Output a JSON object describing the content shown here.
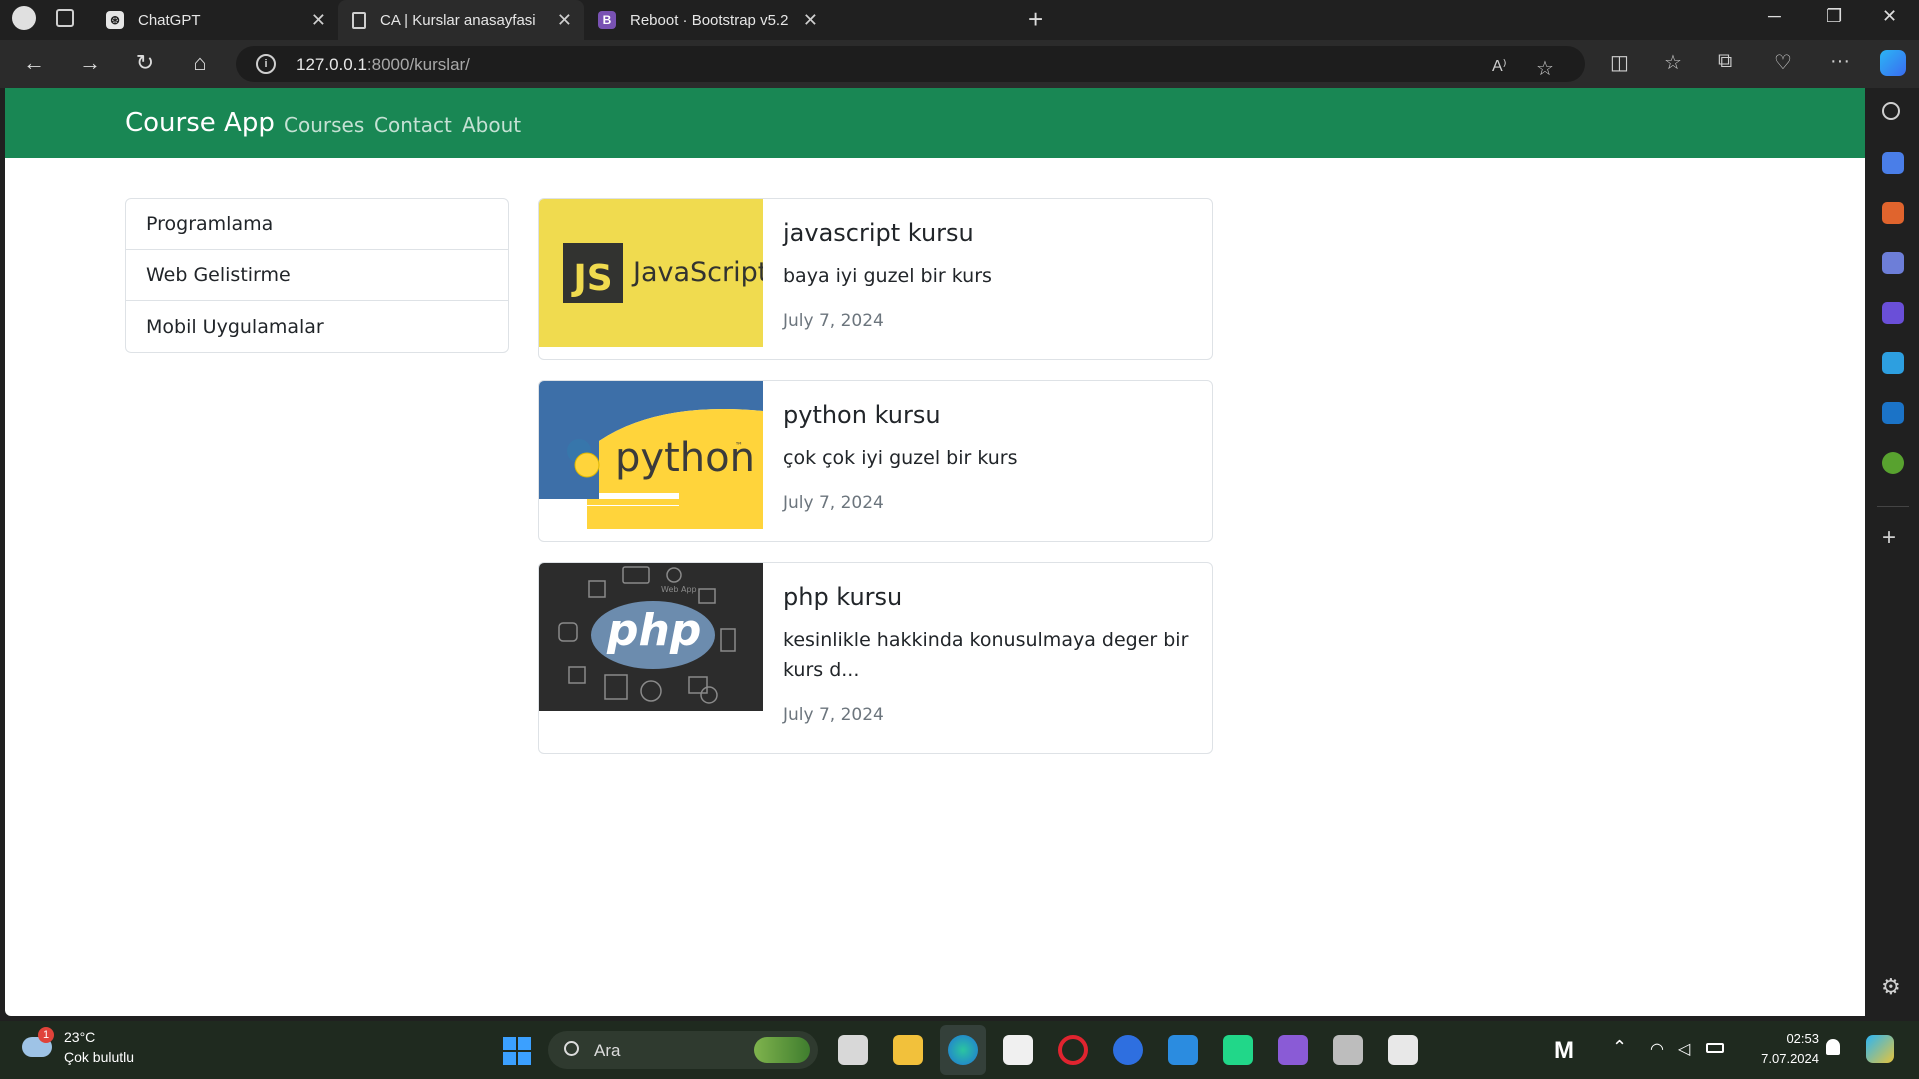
{
  "browser": {
    "tabs": [
      {
        "title": "ChatGPT"
      },
      {
        "title": "CA | Kurslar anasayfasi"
      },
      {
        "title": "Reboot · Bootstrap v5.2"
      }
    ],
    "url_host": "127.0.0.1",
    "url_rest": ":8000/kurslar/",
    "accent": "#198754"
  },
  "navbar": {
    "brand": "Course App",
    "links": [
      "Courses",
      "Contact",
      "About"
    ]
  },
  "categories": [
    "Programlama",
    "Web Gelistirme",
    "Mobil Uygulamalar"
  ],
  "courses": [
    {
      "title": "javascript kursu",
      "description": "baya iyi guzel bir kurs",
      "date": "July 7, 2024",
      "image_label": "JavaScript",
      "badge": "JS"
    },
    {
      "title": "python kursu",
      "description": "çok çok iyi guzel bir kurs",
      "date": "July 7, 2024",
      "image_label": "python",
      "tm": "™"
    },
    {
      "title": "php kursu",
      "description": "kesinlikle hakkinda konusulmaya deger bir kurs d...",
      "date": "July 7, 2024",
      "image_label": "php",
      "caption": "Web App"
    }
  ],
  "taskbar": {
    "weather_temp": "23°C",
    "weather_desc": "Çok bulutlu",
    "weather_badge": "1",
    "search_placeholder": "Ara",
    "time": "02:53",
    "date": "7.07.2024"
  }
}
